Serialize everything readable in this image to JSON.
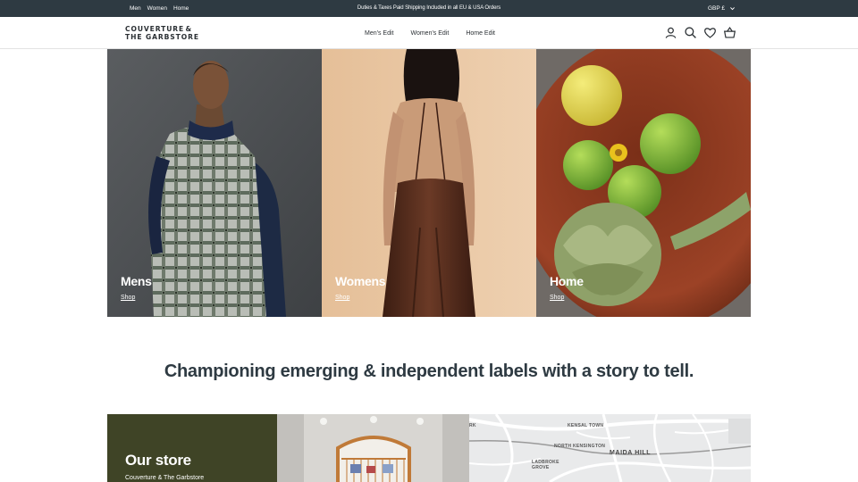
{
  "topbar": {
    "categories": [
      "Men",
      "Women",
      "Home"
    ],
    "promo": "Duties & Taxes Paid Shipping Included in all EU & USA Orders",
    "currency": "GBP £",
    "currency_icon": "chevron-down-icon"
  },
  "header": {
    "logo_line1_a": "COUVERTURE",
    "logo_line1_b": "&",
    "logo_line2": "THE GARBSTORE",
    "nav": [
      "Men's Edit",
      "Women's Edit",
      "Home Edit"
    ],
    "icons": [
      "account-icon",
      "search-icon",
      "wishlist-heart-icon",
      "basket-icon"
    ]
  },
  "hero": {
    "panels": [
      {
        "title": "Mens",
        "link": "Shop"
      },
      {
        "title": "Womens",
        "link": "Shop"
      },
      {
        "title": "Home",
        "link": "Shop"
      }
    ]
  },
  "tagline": "Championing emerging & independent labels with a story to tell.",
  "store": {
    "heading": "Our store",
    "subtitle": "Couverture & The Garbstore"
  },
  "map": {
    "labels": [
      "KENSAL TOWN",
      "NORTH KENSINGTON",
      "LADBROKE GROVE",
      "MAIDA HILL",
      "RK"
    ],
    "colors": {
      "road": "#ffffff",
      "land": "#e9eaeb",
      "rail": "#9a9a9a"
    }
  },
  "colors": {
    "topbar_bg": "#2e3a42",
    "store_bg": "#3f4426",
    "text_dark": "#2e3a42"
  }
}
